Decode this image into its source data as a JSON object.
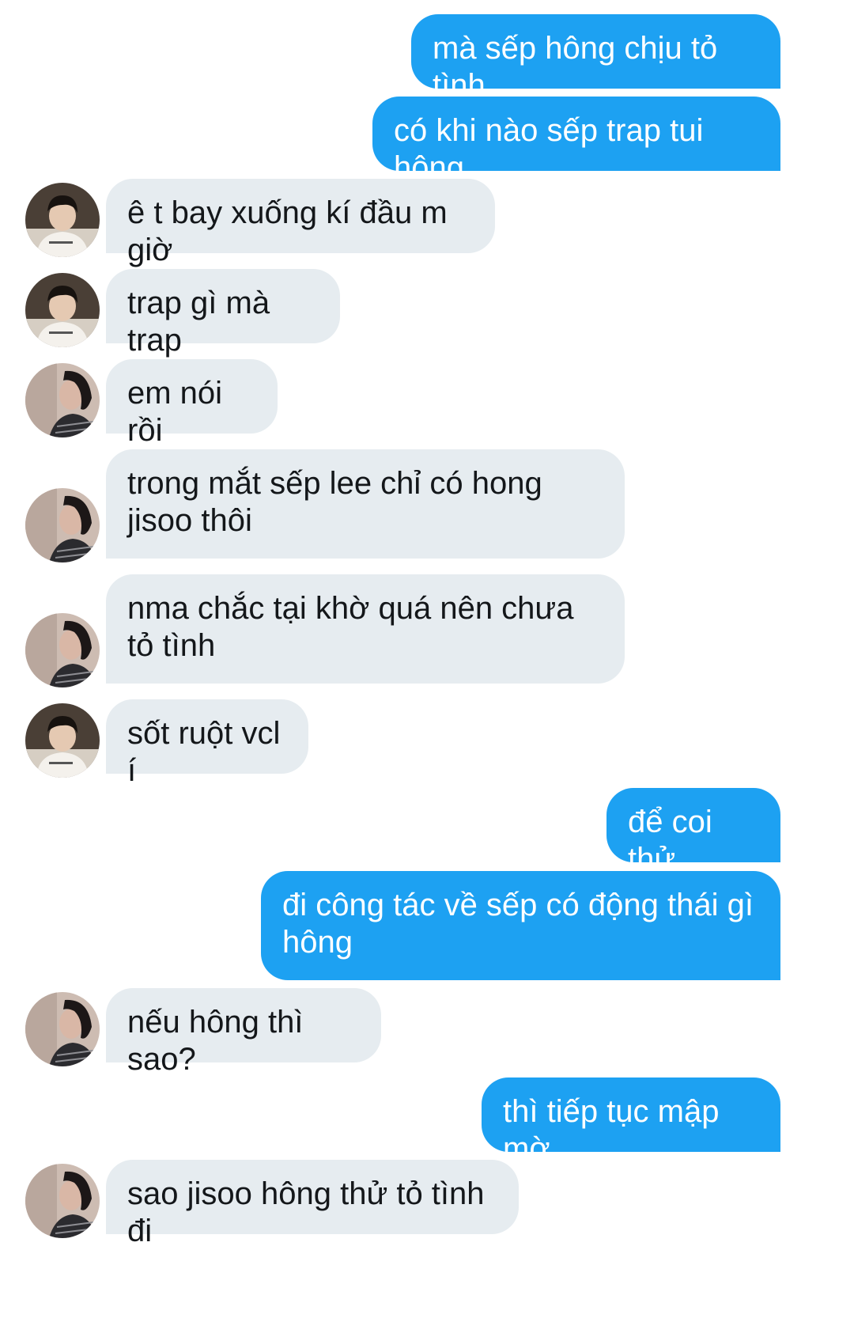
{
  "conversation": {
    "messages": [
      {
        "side": "out",
        "text": "mà sếp hông chịu tỏ tình"
      },
      {
        "side": "out",
        "text": "có khi nào sếp trap tui hông"
      },
      {
        "side": "in",
        "avatar": "avatar-white-tshirt-user",
        "text": "ê t bay xuống kí đầu m giờ"
      },
      {
        "side": "in",
        "avatar": "avatar-white-tshirt-user",
        "text": "trap gì mà trap"
      },
      {
        "side": "in",
        "avatar": "avatar-striped-shirt-user",
        "text": "em nói rồi"
      },
      {
        "side": "in",
        "avatar": "avatar-striped-shirt-user",
        "text": "trong mắt sếp lee chỉ có hong jisoo thôi"
      },
      {
        "side": "in",
        "avatar": "avatar-striped-shirt-user",
        "text": "nma chắc tại khờ quá nên chưa tỏ tình"
      },
      {
        "side": "in",
        "avatar": "avatar-white-tshirt-user",
        "text": "sốt ruột vcl í"
      },
      {
        "side": "out",
        "text": "để coi thử"
      },
      {
        "side": "out",
        "text": "đi công tác về sếp có động thái gì hông"
      },
      {
        "side": "in",
        "avatar": "avatar-striped-shirt-user",
        "text": "nếu hông thì sao?"
      },
      {
        "side": "out",
        "text": "thì tiếp tục mập mờ"
      },
      {
        "side": "in",
        "avatar": "avatar-striped-shirt-user",
        "text": "sao jisoo hông thử tỏ tình đi"
      }
    ]
  },
  "colors": {
    "outgoing_bubble": "#1da1f2",
    "outgoing_text": "#ffffff",
    "incoming_bubble": "#e6ecf0",
    "incoming_text": "#14171a",
    "background": "#ffffff"
  }
}
